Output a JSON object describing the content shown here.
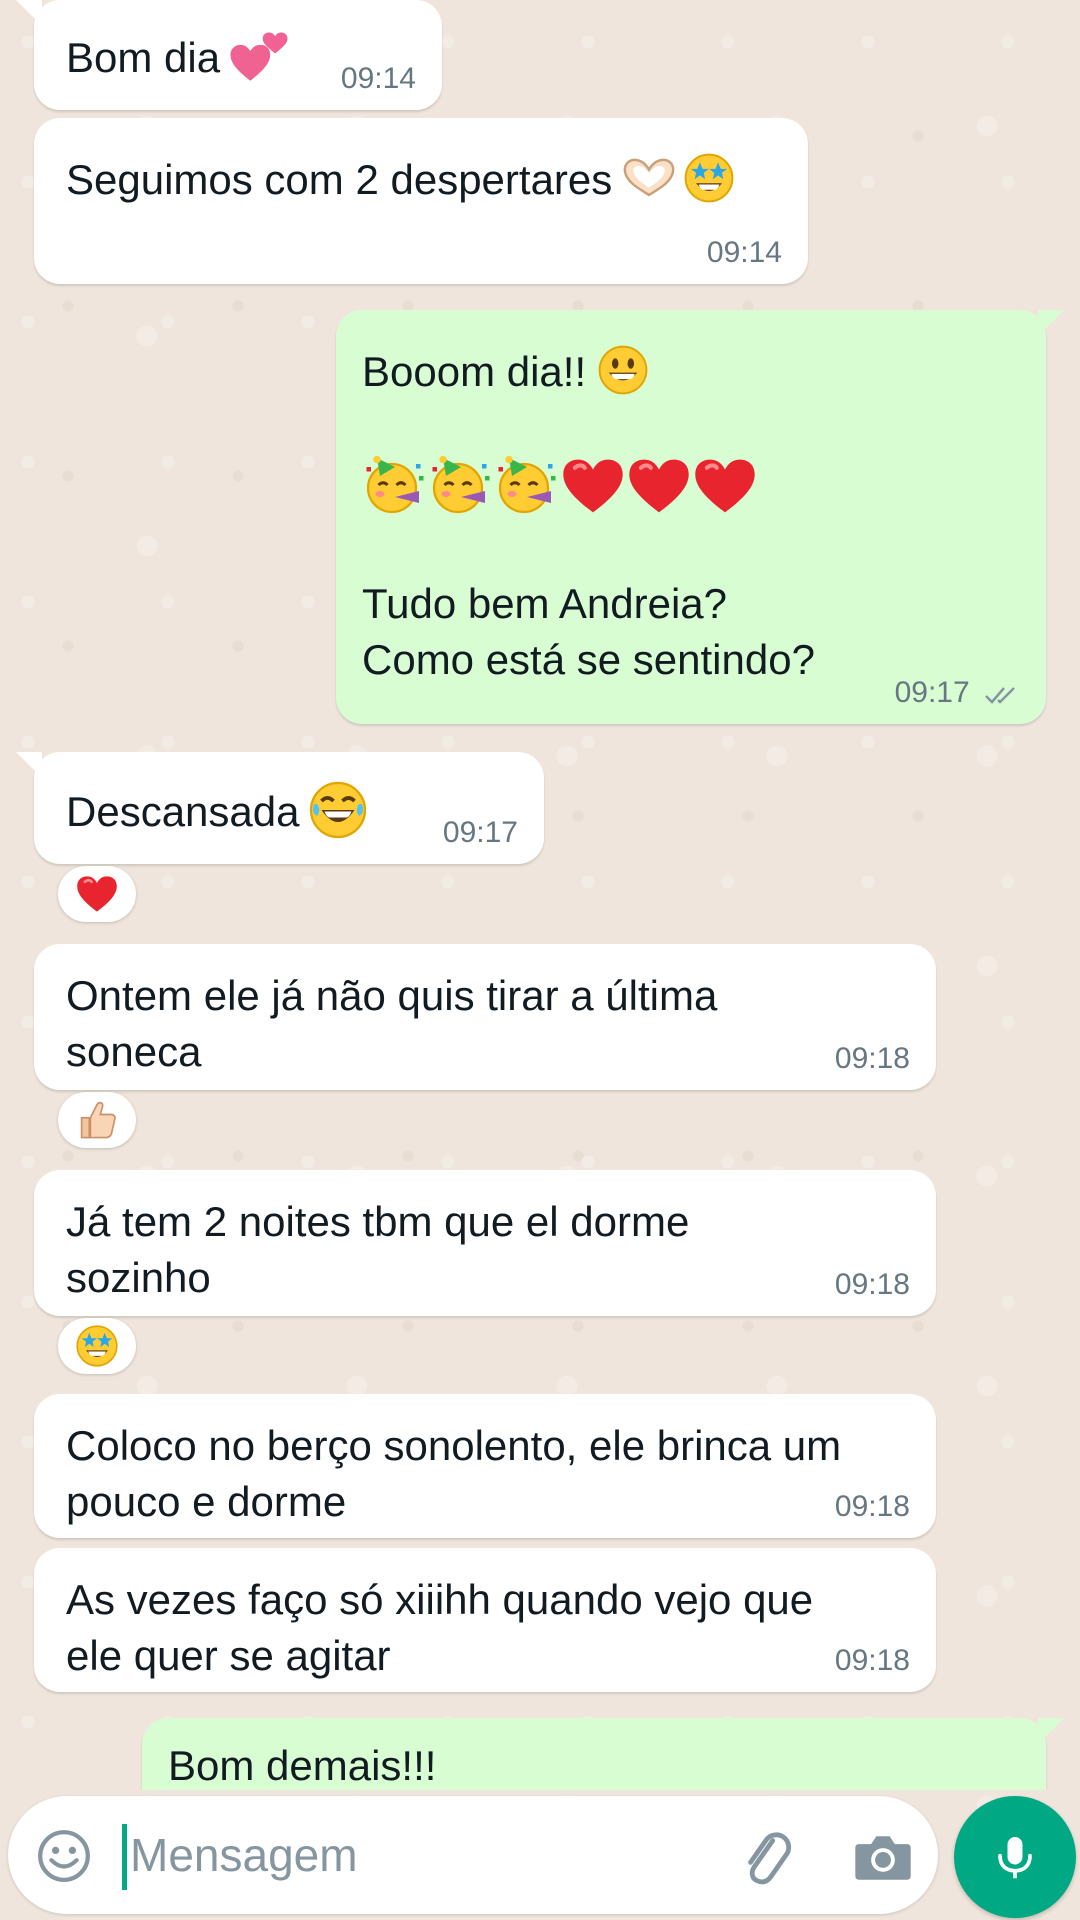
{
  "colors": {
    "incoming_bubble": "#ffffff",
    "outgoing_bubble": "#d9fdd3",
    "accent": "#00a884",
    "timestamp": "#667781",
    "background": "#efe5dc"
  },
  "messages": [
    {
      "direction": "incoming",
      "text": "Bom dia",
      "emoji": [
        "two-hearts-emoji"
      ],
      "time": "09:14"
    },
    {
      "direction": "incoming",
      "text": "Seguimos com 2 despertares",
      "emoji": [
        "heart-hands-emoji",
        "star-struck-emoji"
      ],
      "time": "09:14"
    },
    {
      "direction": "outgoing",
      "text_line1": "Booom dia!!",
      "emoji_line1": [
        "grinning-face-emoji"
      ],
      "emoji_line2": [
        "partying-face-emoji",
        "partying-face-emoji",
        "partying-face-emoji",
        "red-heart-emoji",
        "red-heart-emoji",
        "red-heart-emoji"
      ],
      "text_line3": "Tudo bem Andreia?\nComo está se sentindo?",
      "time": "09:17",
      "status": "read-double-check"
    },
    {
      "direction": "incoming",
      "text": "Descansada",
      "emoji": [
        "tears-of-joy-emoji"
      ],
      "time": "09:17",
      "reaction": "red-heart-emoji"
    },
    {
      "direction": "incoming",
      "text": "Ontem ele já não quis tirar a última\nsoneca",
      "time": "09:18",
      "reaction": "thumbs-up-emoji"
    },
    {
      "direction": "incoming",
      "text": "Já tem 2 noites tbm que el dorme\nsozinho",
      "time": "09:18",
      "reaction": "star-struck-emoji"
    },
    {
      "direction": "incoming",
      "text": "Coloco no berço sonolento, ele brinca um\npouco e dorme",
      "time": "09:18"
    },
    {
      "direction": "incoming",
      "text": "As vezes faço só xiiihh quando vejo que\nele quer se agitar",
      "time": "09:18"
    },
    {
      "direction": "outgoing",
      "text": "Bom demais!!!"
    }
  ],
  "composer": {
    "placeholder": "Mensagem",
    "value": "",
    "icons": [
      "emoji-icon",
      "attach-icon",
      "camera-icon",
      "mic-icon"
    ]
  }
}
